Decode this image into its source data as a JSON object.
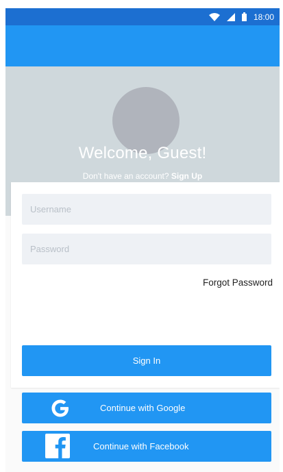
{
  "status_bar": {
    "time": "18:00",
    "icons": [
      "wifi-icon",
      "signal-icon",
      "battery-icon"
    ],
    "background": "#1c6fd1"
  },
  "app_bar": {
    "background": "#2196f3"
  },
  "header": {
    "background": "#cfd8dc",
    "welcome": "Welcome, Guest!",
    "signup_prompt": "Don't have an account?",
    "signup_link": "Sign Up"
  },
  "form": {
    "username": {
      "placeholder": "Username",
      "value": ""
    },
    "password": {
      "placeholder": "Password",
      "value": ""
    },
    "forgot_label": "Forgot Password",
    "signin_label": "Sign In"
  },
  "social": {
    "google": {
      "label": "Continue with Google",
      "icon": "google-icon"
    },
    "facebook": {
      "label": "Continue with Facebook",
      "icon": "facebook-icon"
    }
  },
  "colors": {
    "primary": "#2196f3",
    "input_bg": "#eef1f5",
    "avatar": "#b0b4bc"
  }
}
